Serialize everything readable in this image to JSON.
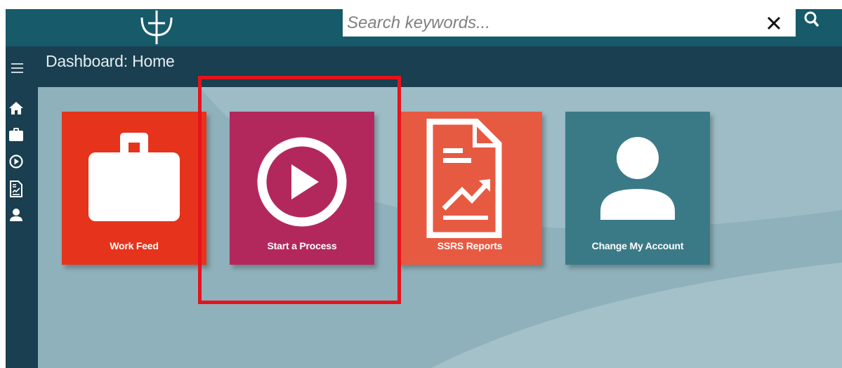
{
  "search": {
    "placeholder": "Search keywords...",
    "value": ""
  },
  "header": {
    "title": "Dashboard: Home"
  },
  "sidebar": {
    "items": [
      {
        "icon": "home-icon"
      },
      {
        "icon": "briefcase-icon"
      },
      {
        "icon": "play-circle-icon"
      },
      {
        "icon": "report-icon"
      },
      {
        "icon": "user-icon"
      }
    ]
  },
  "tiles": [
    {
      "label": "Work Feed",
      "icon": "briefcase-icon",
      "color": "#e5341b"
    },
    {
      "label": "Start a Process",
      "icon": "play-circle-icon",
      "color": "#b3285c"
    },
    {
      "label": "SSRS Reports",
      "icon": "report-icon",
      "color": "#e75a42"
    },
    {
      "label": "Change My Account",
      "icon": "user-icon",
      "color": "#3a7a87"
    }
  ],
  "colors": {
    "topbar": "#175a6a",
    "subbar": "#193f50",
    "content_bg": "#8fb1bb",
    "highlight": "#e8121b"
  }
}
